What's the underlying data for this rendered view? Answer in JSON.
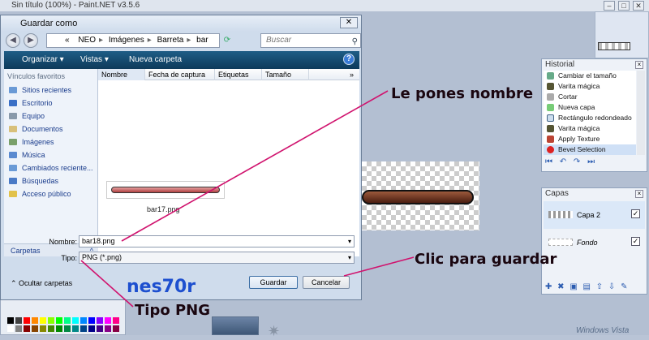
{
  "window": {
    "title": "Sin título (100%) - Paint.NET v3.5.6",
    "min": "–",
    "max": "□",
    "close": "✕"
  },
  "dialog": {
    "title": "Guardar como",
    "close": "✕",
    "path": [
      "«",
      "NEO",
      "Imágenes",
      "Barreta",
      "bar"
    ],
    "search_placeholder": "Buscar",
    "toolbar": {
      "organize": "Organizar ▾",
      "views": "Vistas ▾",
      "new_folder": "Nueva carpeta",
      "help": "?"
    },
    "favorites_title": "Vínculos favoritos",
    "favorites": [
      "Sitios recientes",
      "Escritorio",
      "Equipo",
      "Documentos",
      "Imágenes",
      "Música",
      "Cambiados reciente...",
      "Búsquedas",
      "Acceso público"
    ],
    "folders_label": "Carpetas",
    "folders_toggle": "^",
    "columns": [
      "Nombre",
      "Fecha de captura",
      "Etiquetas",
      "Tamaño"
    ],
    "columns_more": "»",
    "file_name": "bar17.png",
    "name_label": "Nombre:",
    "name_value": "bar18.png",
    "type_label": "Tipo:",
    "type_value": "PNG (*.png)",
    "hide_folders": "Ocultar carpetas",
    "save": "Guardar",
    "cancel": "Cancelar",
    "watermark": "nes70r"
  },
  "history": {
    "title": "Historial",
    "items": [
      "Cambiar el tamaño",
      "Varita mágica",
      "Cortar",
      "Nueva capa",
      "Rectángulo redondeado",
      "Varita mágica",
      "Apply Texture",
      "Bevel Selection"
    ],
    "tools": "⏮ ↶ ↷ ⏭"
  },
  "layers": {
    "title": "Capas",
    "items": [
      {
        "name": "Capa 2",
        "visible": "✓"
      },
      {
        "name": "Fondo",
        "visible": "✓"
      }
    ],
    "tools": "✚ ✖ ▣ ▤ ⇧ ⇩ ✎"
  },
  "annotations": {
    "name": "Le pones nombre",
    "save": "Clic para guardar",
    "type": "Tipo PNG"
  },
  "brand": "Windows Vista"
}
